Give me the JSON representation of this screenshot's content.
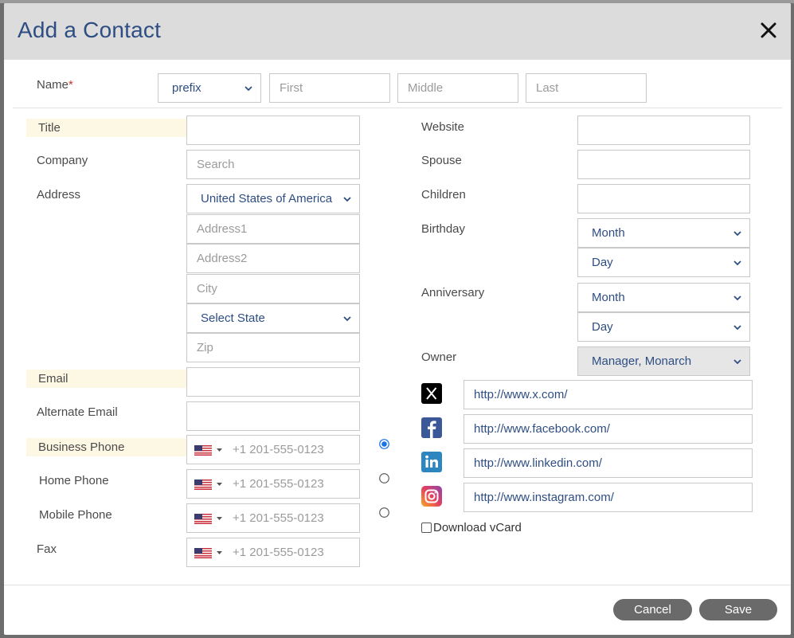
{
  "dialog": {
    "title": "Add a Contact"
  },
  "name": {
    "label": "Name",
    "required_mark": "*",
    "prefix": "prefix",
    "first_placeholder": "First",
    "middle_placeholder": "Middle",
    "last_placeholder": "Last"
  },
  "left": {
    "title_label": "Title",
    "company_label": "Company",
    "company_placeholder": "Search",
    "address_label": "Address",
    "country": "United States of America",
    "address1_placeholder": "Address1",
    "address2_placeholder": "Address2",
    "city_placeholder": "City",
    "state": "Select State",
    "zip_placeholder": "Zip",
    "email_label": "Email",
    "alt_email_label": "Alternate Email",
    "business_phone_label": "Business Phone",
    "home_phone_label": "Home Phone",
    "mobile_phone_label": "Mobile Phone",
    "fax_label": "Fax",
    "phone_placeholder": "+1 201-555-0123"
  },
  "right": {
    "website_label": "Website",
    "spouse_label": "Spouse",
    "children_label": "Children",
    "birthday_label": "Birthday",
    "birthday_month": "Month",
    "birthday_day": "Day",
    "anniversary_label": "Anniversary",
    "anniversary_month": "Month",
    "anniversary_day": "Day",
    "owner_label": "Owner",
    "owner": "Manager, Monarch"
  },
  "social": {
    "x_url": "http://www.x.com/",
    "facebook_url": "http://www.facebook.com/",
    "linkedin_url": "http://www.linkedin.com/",
    "instagram_url": "http://www.instagram.com/",
    "download_vcard_label": "Download vCard"
  },
  "footer": {
    "cancel_label": "Cancel",
    "save_label": "Save"
  },
  "colors": {
    "accent": "#2e4e83",
    "highlight": "#fdf8e4",
    "button": "#6a6a6a",
    "radio": "#1a73e8"
  }
}
